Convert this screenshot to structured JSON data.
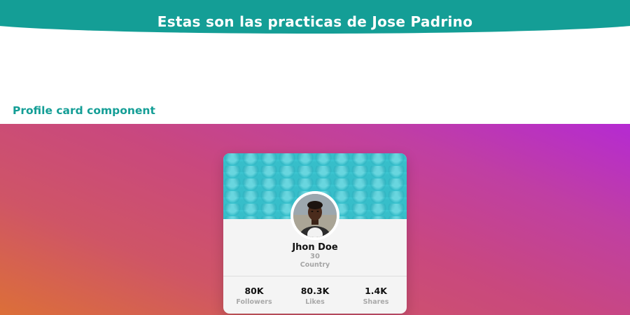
{
  "header": {
    "title": "Estas son las practicas de Jose Padrino"
  },
  "section": {
    "title": "Profile card component"
  },
  "card": {
    "name": "Jhon Doe",
    "age": "30",
    "country": "Country",
    "stats": [
      {
        "value": "80K",
        "label": "Followers"
      },
      {
        "value": "80.3K",
        "label": "Likes"
      },
      {
        "value": "1.4K",
        "label": "Shares"
      }
    ]
  },
  "colors": {
    "header": "#149e96",
    "section_title": "#149e96",
    "gradient_start": "#dc6f38",
    "gradient_end": "#b52ad2",
    "card_cover": "#3fcbd6"
  }
}
